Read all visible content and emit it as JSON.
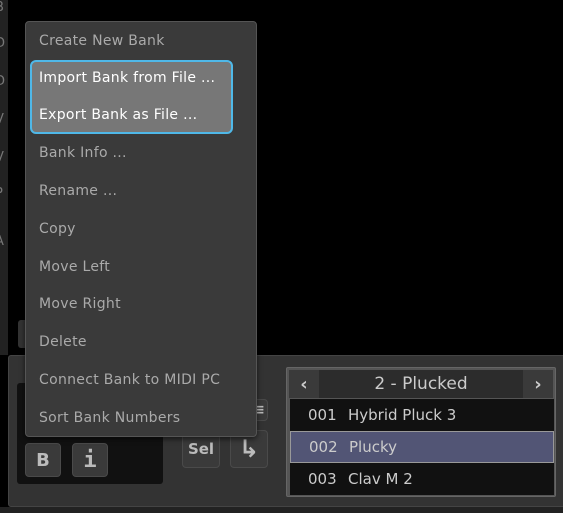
{
  "left_strip_letters": [
    "B",
    "D",
    "D",
    "V",
    "V",
    "P",
    "A"
  ],
  "menu": {
    "items": [
      {
        "label": "Create New Bank"
      },
      {
        "label": "Import Bank from File ..."
      },
      {
        "label": "Export Bank as File ..."
      },
      {
        "label": "Bank Info ..."
      },
      {
        "label": "Rename ..."
      },
      {
        "label": "Copy"
      },
      {
        "label": "Move Left"
      },
      {
        "label": "Move Right"
      },
      {
        "label": "Delete"
      },
      {
        "label": "Connect Bank to MIDI PC"
      },
      {
        "label": "Sort Bank Numbers"
      }
    ]
  },
  "buttons": {
    "bank_sort_icon": "B",
    "info": "i",
    "sel": "Sel",
    "enter_icon": "↳",
    "list_icon": "≡"
  },
  "preset": {
    "bank_title": "2 - Plucked",
    "prev": "‹",
    "next": "›",
    "rows": [
      {
        "num": "001",
        "name": "Hybrid Pluck 3"
      },
      {
        "num": "002",
        "name": "Plucky"
      },
      {
        "num": "003",
        "name": "Clav M 2"
      }
    ]
  },
  "colors": {
    "highlight_border": "#4fb8e8",
    "selected_row": "#525575"
  }
}
